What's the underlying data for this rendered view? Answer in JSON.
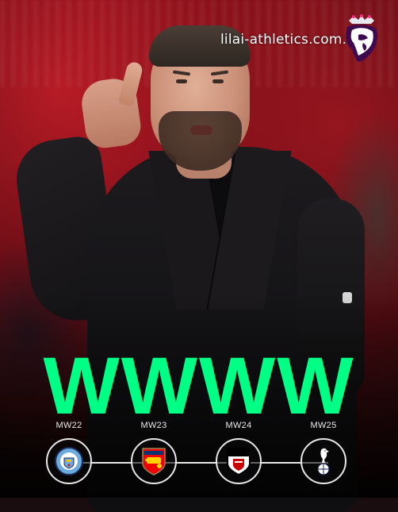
{
  "watermark": "lilai-athletics.com.cn",
  "headline": "WWWW",
  "accent_color": "#00ff85",
  "competition_badge": "premier-league-lion-icon",
  "matches": [
    {
      "label": "MW22",
      "crest": "manchester-city-crest-icon"
    },
    {
      "label": "MW23",
      "crest": "arsenal-crest-icon"
    },
    {
      "label": "MW24",
      "crest": "fulham-crest-icon"
    },
    {
      "label": "MW25",
      "crest": "tottenham-crest-icon"
    }
  ]
}
